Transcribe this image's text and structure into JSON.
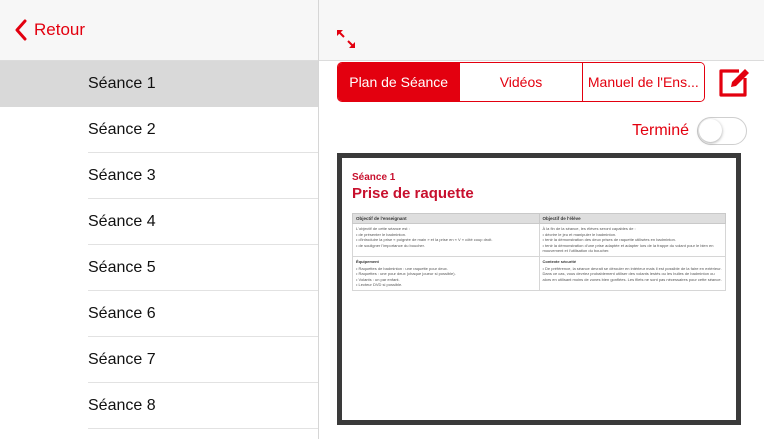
{
  "sidebar": {
    "back_label": "Retour",
    "sessions": [
      "Séance 1",
      "Séance 2",
      "Séance 3",
      "Séance 4",
      "Séance 5",
      "Séance 6",
      "Séance 7",
      "Séance 8"
    ],
    "selected_index": 0
  },
  "tabs": [
    {
      "label": "Plan de Séance",
      "active": true
    },
    {
      "label": "Vidéos",
      "active": false
    },
    {
      "label": "Manuel de l'Ens...",
      "active": false
    }
  ],
  "done": {
    "label": "Terminé",
    "checked": false
  },
  "document": {
    "kicker": "Séance 1",
    "title": "Prise de raquette",
    "col_left": "Objectif de l'enseignant",
    "col_right": "Objectif de l'élève",
    "left_intro": "L'objectif de cette séance est :",
    "left_bullets": [
      "• de présenter le badminton.",
      "• d'introduire la prise « poignée de main » et la prise en « V » côté coup droit.",
      "• de souligner l'importance du boucher."
    ],
    "right_intro": "À la fin de la séance, les élèves seront capables de :",
    "right_bullets": [
      "• décrire le jeu et manipuler le badminton.",
      "• tenir la démonstration des deux prises de raquette utilisées en badminton.",
      "• tenir la démonstration d'une prise adaptée et adapter lors de la frappe du volant pour le bien en mouvement et l'utilisation du boucher."
    ],
    "equipment_title": "Équipement",
    "equipment_items": [
      "• Raquettes de badminton : une raquette pour deux.",
      "• Raquettes : une pour deux (chaque joueur si possible).",
      "• Volants : un par enfant.",
      "• Lecteur DVD si possible."
    ],
    "safety_title": "Contexte sécurité",
    "safety_text": "• De préférence, la séance devrait se dérouler en intérieur mais il est possible de la faire en extérieur. Dans ce cas, vous devriez probablement utiliser des volants lestés ou les bulles de badminton ou alors en utilisant moins de zones bien gonflées. Les filets ne sont pas nécessaires pour cette séance."
  },
  "colors": {
    "accent": "#e3000f",
    "doc_red": "#c8102e",
    "selected_row": "#d9d9d9"
  },
  "icons": {
    "back": "chevron-left-icon",
    "expand": "expand-arrows-icon",
    "edit": "edit-pencil-icon"
  }
}
